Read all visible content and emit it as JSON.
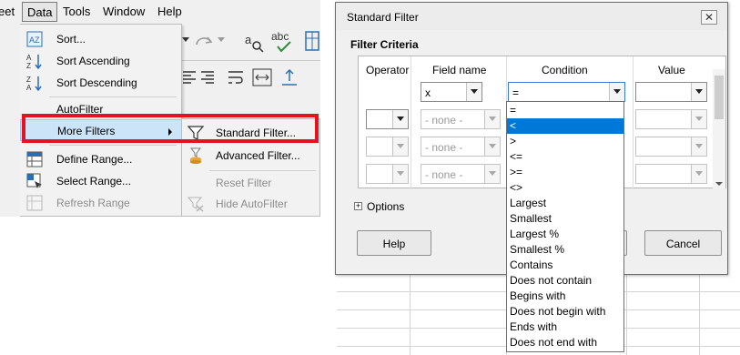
{
  "menubar": {
    "items": [
      {
        "label": "eet"
      },
      {
        "label": "Data"
      },
      {
        "label": "Tools"
      },
      {
        "label": "Window"
      },
      {
        "label": "Help"
      }
    ]
  },
  "data_menu": {
    "items": [
      {
        "label": "Sort...",
        "icon": "sort-dialog-icon",
        "disabled": false
      },
      {
        "label": "Sort Ascending",
        "icon": "sort-ascending-icon",
        "disabled": false
      },
      {
        "label": "Sort Descending",
        "icon": "sort-descending-icon",
        "disabled": false
      },
      {
        "label": "AutoFilter",
        "icon": "autofilter-icon",
        "disabled": false
      },
      {
        "label": "More Filters",
        "icon": "",
        "disabled": false,
        "highlighted": true,
        "has_submenu": true
      },
      {
        "label": "Define Range...",
        "icon": "define-range-icon",
        "disabled": false
      },
      {
        "label": "Select Range...",
        "icon": "select-range-icon",
        "disabled": false
      },
      {
        "label": "Refresh Range",
        "icon": "refresh-range-icon",
        "disabled": true
      }
    ]
  },
  "more_filters_submenu": {
    "items": [
      {
        "label": "Standard Filter...",
        "icon": "funnel-icon",
        "disabled": false
      },
      {
        "label": "Advanced Filter...",
        "icon": "advanced-filter-icon",
        "disabled": false
      },
      {
        "label": "Reset Filter",
        "icon": "",
        "disabled": true
      },
      {
        "label": "Hide AutoFilter",
        "icon": "hide-autofilter-icon",
        "disabled": true
      }
    ]
  },
  "dialog": {
    "title": "Standard Filter",
    "close_label": "✕",
    "criteria_title": "Filter Criteria",
    "columns": {
      "operator": "Operator",
      "field_name": "Field name",
      "condition": "Condition",
      "value": "Value"
    },
    "rows": [
      {
        "operator": "",
        "field": "x",
        "condition": "=",
        "value": ""
      },
      {
        "operator": "",
        "field": "- none -",
        "condition": "",
        "value": ""
      },
      {
        "operator": "",
        "field": "- none -",
        "condition": "",
        "value": ""
      },
      {
        "operator": "",
        "field": "- none -",
        "condition": "",
        "value": ""
      }
    ],
    "options_label": "Options",
    "help_label": "Help",
    "cancel_label": "Cancel"
  },
  "condition_dropdown": {
    "options": [
      "=",
      "<",
      ">",
      "<=",
      ">=",
      "<>",
      "Largest",
      "Smallest",
      "Largest %",
      "Smallest %",
      "Contains",
      "Does not contain",
      "Begins with",
      "Does not begin with",
      "Ends with",
      "Does not end with"
    ],
    "selected": "<"
  },
  "colors": {
    "highlight_red": "#e3141d",
    "selection_blue": "#0078d7",
    "menu_highlight": "#cce4f7"
  }
}
